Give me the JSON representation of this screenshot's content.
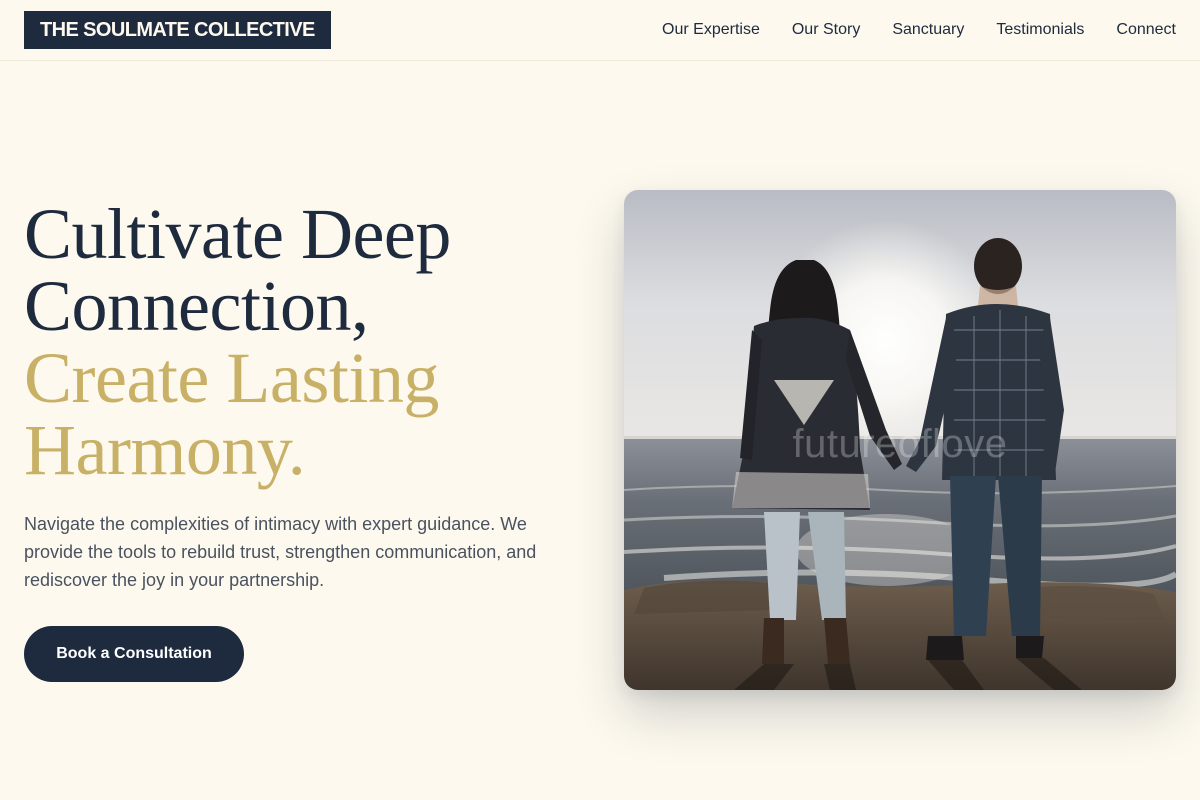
{
  "header": {
    "logo": "THE SOULMATE COLLECTIVE",
    "nav": [
      {
        "label": "Our Expertise"
      },
      {
        "label": "Our Story"
      },
      {
        "label": "Sanctuary"
      },
      {
        "label": "Testimonials"
      },
      {
        "label": "Connect"
      }
    ]
  },
  "hero": {
    "title_line1": "Cultivate Deep",
    "title_line2": "Connection,",
    "title_line3": "Create Lasting",
    "title_line4": "Harmony.",
    "description": "Navigate the complexities of intimacy with expert guidance. We provide the tools to rebuild trust, strengthen communication, and rediscover the joy in your partnership.",
    "cta_label": "Book a Consultation",
    "image_watermark": "futureoflove"
  },
  "colors": {
    "background": "#fdf9ee",
    "navy": "#1e2a3e",
    "gold": "#c8b166",
    "body_text": "#4a5260"
  }
}
